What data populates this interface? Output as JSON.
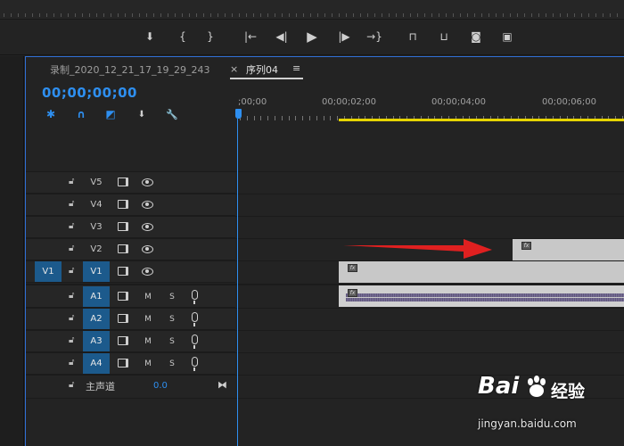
{
  "transport": {
    "buttons": [
      {
        "name": "add-marker-button",
        "glyph": "⬇"
      },
      {
        "name": "mark-in-button",
        "glyph": "{"
      },
      {
        "name": "mark-out-button",
        "glyph": "}"
      },
      {
        "name": "go-to-in-button",
        "glyph": "|←"
      },
      {
        "name": "step-back-button",
        "glyph": "◀|"
      },
      {
        "name": "play-button",
        "glyph": "▶"
      },
      {
        "name": "step-forward-button",
        "glyph": "|▶"
      },
      {
        "name": "go-to-out-button",
        "glyph": "→}"
      },
      {
        "name": "lift-button",
        "glyph": "⊓"
      },
      {
        "name": "extract-button",
        "glyph": "⊔"
      },
      {
        "name": "export-frame-button",
        "glyph": "◙"
      },
      {
        "name": "comparison-view-button",
        "glyph": "▣"
      }
    ]
  },
  "tabs": {
    "inactive": "录制_2020_12_21_17_19_29_243",
    "close_glyph": "×",
    "active": "序列04",
    "menu_glyph": "≡"
  },
  "timecode": "00;00;00;00",
  "tools": [
    {
      "name": "nest-toggle-icon",
      "glyph": "✱"
    },
    {
      "name": "snap-icon",
      "glyph": "∩"
    },
    {
      "name": "linked-selection-icon",
      "glyph": "◩"
    },
    {
      "name": "add-marker-icon",
      "glyph": "⬇"
    },
    {
      "name": "wrench-icon",
      "glyph": "🔧"
    }
  ],
  "ruler": {
    "labels": [
      ";00;00",
      "00;00;02;00",
      "00;00;04;00",
      "00;00;06;00"
    ]
  },
  "video_tracks": [
    {
      "name": "V5"
    },
    {
      "name": "V4"
    },
    {
      "name": "V3"
    },
    {
      "name": "V2"
    },
    {
      "name": "V1",
      "source": "V1"
    }
  ],
  "audio_tracks": [
    {
      "name": "A1",
      "mute": "M",
      "solo": "S"
    },
    {
      "name": "A2",
      "mute": "M",
      "solo": "S"
    },
    {
      "name": "A3",
      "mute": "M",
      "solo": "S"
    },
    {
      "name": "A4",
      "mute": "M",
      "solo": "S"
    }
  ],
  "master": {
    "label": "主声道",
    "value": "0.0",
    "end_glyph": "⧓"
  },
  "clips": {
    "fx_label": "fx"
  },
  "annotation": {
    "arrow_color": "#e02020"
  },
  "watermark": {
    "brand": "Bai",
    "brand_suffix": "经验",
    "site": "jingyan.baidu.com"
  }
}
